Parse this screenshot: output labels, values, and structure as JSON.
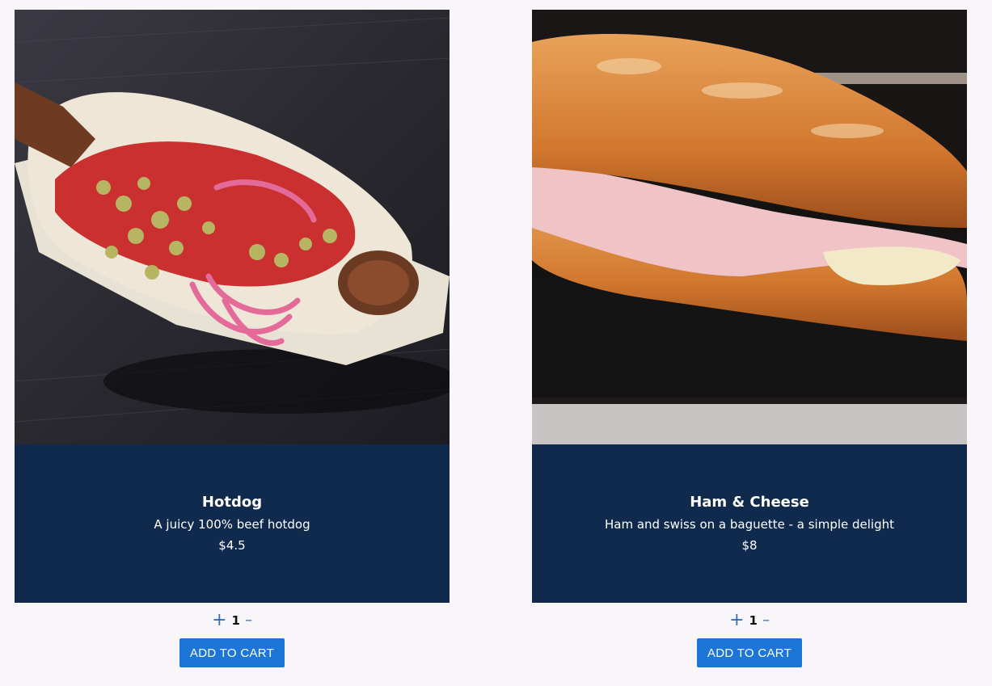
{
  "products": [
    {
      "name": "Hotdog",
      "description": "A juicy 100% beef hotdog",
      "price": "$4.5",
      "quantity": "1",
      "increment_label": "+",
      "decrement_label": "–",
      "add_to_cart_label": "ADD TO CART",
      "image_icon": "hotdog-photo"
    },
    {
      "name": "Ham & Cheese",
      "description": "Ham and swiss on a baguette - a simple delight",
      "price": "$8",
      "quantity": "1",
      "increment_label": "+",
      "decrement_label": "–",
      "add_to_cart_label": "ADD TO CART",
      "image_icon": "sandwich-photo"
    }
  ],
  "colors": {
    "card_info_bg": "#0f2a4c",
    "button_bg": "#1c76d8",
    "qty_control": "#3a6fb0",
    "page_bg": "#f8f6f8"
  }
}
